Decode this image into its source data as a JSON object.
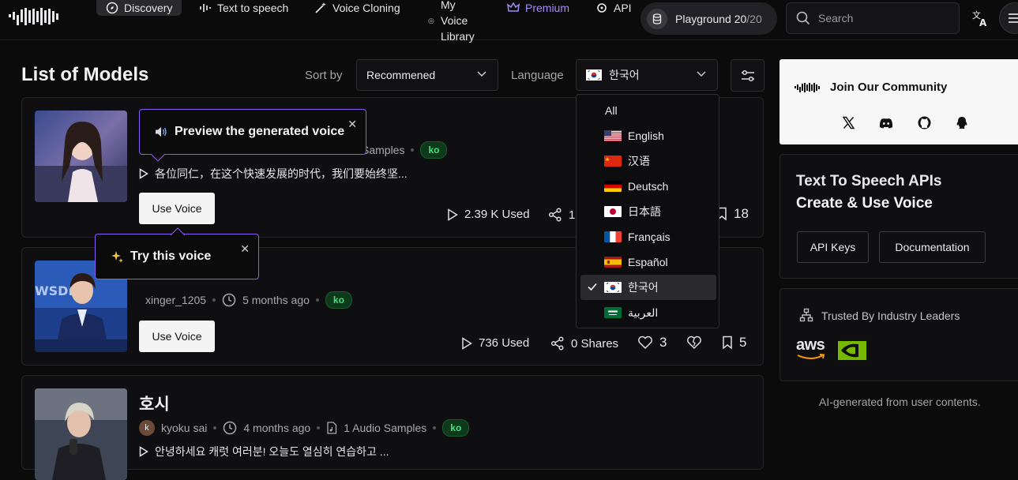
{
  "nav": {
    "items": [
      {
        "label": "Discovery",
        "icon": "compass-icon"
      },
      {
        "label": "Text to speech",
        "icon": "waveform-icon"
      },
      {
        "label": "Voice Cloning",
        "icon": "magic-wand-icon"
      },
      {
        "label": "Premium",
        "icon": "crown-icon"
      },
      {
        "label": "API",
        "icon": "api-icon"
      }
    ],
    "voice_library": [
      "My",
      "Voice",
      "Library"
    ],
    "playground_label": "Playground 20",
    "playground_suffix": "/20",
    "search_placeholder": "Search"
  },
  "list": {
    "title": "List of Models",
    "sort_label": "Sort by",
    "sort_value": "Recommened",
    "language_label": "Language",
    "language_value": "한국어"
  },
  "cards": [
    {
      "samples": "Samples",
      "badge": "ko",
      "description": "各位同仁，在这个快速发展的时代，我们要始终坚...",
      "button": "Use Voice",
      "used": "2.39 K Used",
      "shares": "1",
      "saves": "18"
    },
    {
      "author": "xinger_1205",
      "time": "5 months ago",
      "badge": "ko",
      "button": "Use Voice",
      "used": "736 Used",
      "shares": "0 Shares",
      "likes": "3",
      "saves": "5"
    },
    {
      "title": "호시",
      "avatar_letter": "k",
      "author": "kyoku sai",
      "time": "4 months ago",
      "samples": "1 Audio Samples",
      "badge": "ko",
      "description": "안녕하세요 캐럿 여러분! 오늘도 열심히 연습하고 ..."
    }
  ],
  "tooltips": {
    "preview": "Preview the generated voice",
    "try": "Try this voice"
  },
  "languages": [
    {
      "name": "All",
      "flag": ""
    },
    {
      "name": "English",
      "flag": "us"
    },
    {
      "name": "汉语",
      "flag": "cn"
    },
    {
      "name": "Deutsch",
      "flag": "de"
    },
    {
      "name": "日本語",
      "flag": "jp"
    },
    {
      "name": "Français",
      "flag": "fr"
    },
    {
      "name": "Español",
      "flag": "es"
    },
    {
      "name": "한국어",
      "flag": "kr",
      "selected": true
    },
    {
      "name": "العربية",
      "flag": "sa"
    }
  ],
  "sidebar": {
    "community_title": "Join Our Community",
    "api_title": "Text To Speech APIs",
    "api_subtitle": "Create & Use Voice",
    "api_keys": "API Keys",
    "documentation": "Documentation",
    "trusted_title": "Trusted By Industry Leaders",
    "aws": "aws",
    "footer": "AI-generated from user contents."
  },
  "colors": {
    "accent": "#8b5cf6",
    "badge_green": "#4ade80",
    "premium": "#a58af5"
  }
}
